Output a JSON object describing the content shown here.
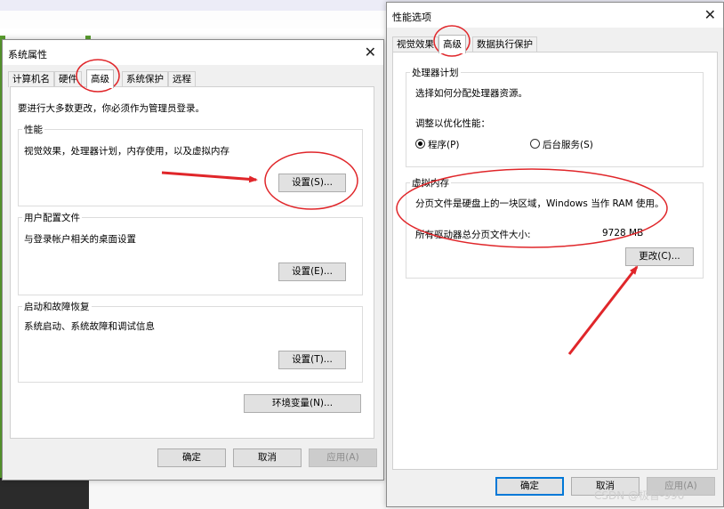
{
  "sys": {
    "title": "系统属性",
    "tabs": [
      "计算机名",
      "硬件",
      "高级",
      "系统保护",
      "远程"
    ],
    "admin_note": "要进行大多数更改，你必须作为管理员登录。",
    "perf": {
      "title": "性能",
      "desc": "视觉效果，处理器计划，内存使用，以及虚拟内存",
      "button": "设置(S)..."
    },
    "profile": {
      "title": "用户配置文件",
      "desc": "与登录帐户相关的桌面设置",
      "button": "设置(E)..."
    },
    "startup": {
      "title": "启动和故障恢复",
      "desc": "系统启动、系统故障和调试信息",
      "button": "设置(T)..."
    },
    "env_button": "环境变量(N)...",
    "ok": "确定",
    "cancel": "取消",
    "apply": "应用(A)"
  },
  "perf": {
    "title": "性能选项",
    "tabs": [
      "视觉效果",
      "高级",
      "数据执行保护"
    ],
    "sched": {
      "title": "处理器计划",
      "desc": "选择如何分配处理器资源。",
      "adjust": "调整以优化性能：",
      "opt1": "程序(P)",
      "opt2": "后台服务(S)"
    },
    "vm": {
      "title": "虚拟内存",
      "desc": "分页文件是硬盘上的一块区域，Windows 当作 RAM 使用。",
      "total_label": "所有驱动器总分页文件大小:",
      "total_value": "9728 MB",
      "change_button": "更改(C)..."
    },
    "ok": "确定",
    "cancel": "取消",
    "apply": "应用(A)"
  },
  "watermark": "CSDN @极智-996",
  "annotation_color": "#e0262a"
}
